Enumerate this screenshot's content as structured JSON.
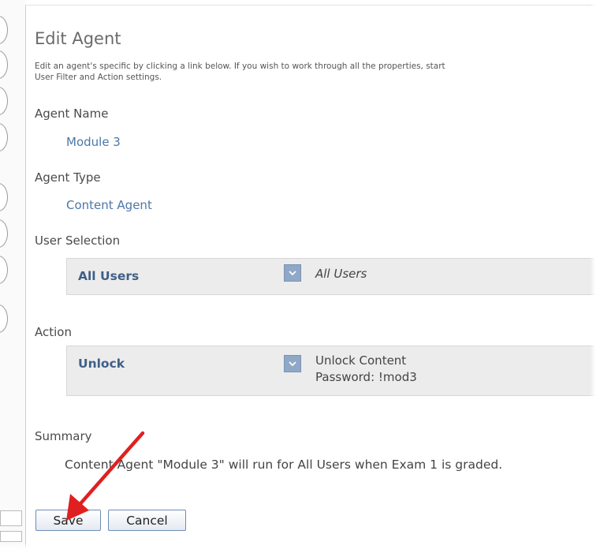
{
  "dialog": {
    "title": "Edit Agent",
    "description_line1": "Edit an agent's specific by clicking a link below. If you wish to work through all the properties, start",
    "description_line2": "User Filter and Action settings."
  },
  "agent_name": {
    "label": "Agent Name",
    "value": "Module 3"
  },
  "agent_type": {
    "label": "Agent Type",
    "value": "Content Agent"
  },
  "user_selection": {
    "label": "User Selection",
    "name": "All Users",
    "detail": "All Users"
  },
  "action": {
    "label": "Action",
    "name": "Unlock",
    "detail_line1": "Unlock Content",
    "detail_line2": "Password: !mod3"
  },
  "summary": {
    "label": "Summary",
    "text": "Content Agent \"Module 3\" will run for All Users when Exam 1 is graded."
  },
  "buttons": {
    "save": "Save",
    "cancel": "Cancel"
  },
  "colors": {
    "link": "#4c77a6",
    "rule_name": "#3f5f87",
    "arrow": "#e02020",
    "dropdown": "#8fa8c7"
  },
  "icons": {
    "dropdown": "chevron-down-icon",
    "annotation": "red-arrow-icon"
  }
}
